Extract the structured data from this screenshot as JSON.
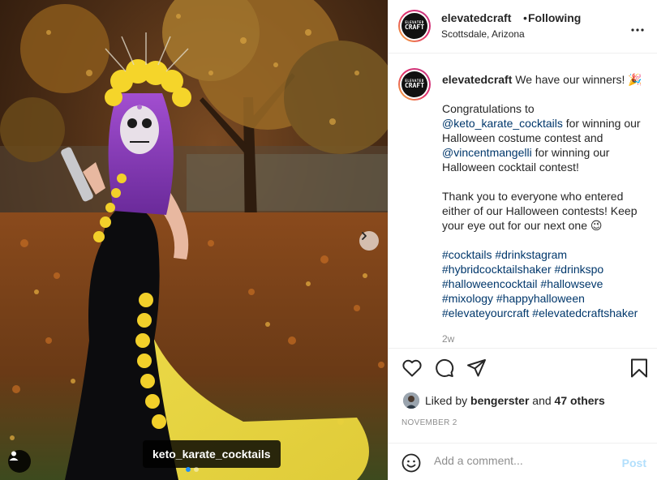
{
  "post": {
    "photo": {
      "tagged_user": "keto_karate_cocktails",
      "carousel_count": 2,
      "carousel_active_index": 0,
      "icons": {
        "next": "chevron-right-icon",
        "tagged": "user-icon"
      }
    },
    "header": {
      "avatar_text_line1": "ELEVATED",
      "avatar_text_line2": "CRAFT",
      "username": "elevatedcraft",
      "separator": "•",
      "follow_status": "Following",
      "location": "Scottsdale, Arizona",
      "more_icon": "more-horizontal-icon"
    },
    "caption": {
      "username": "elevatedcraft",
      "first_line": "We have our winners! 🎉",
      "para1_before": "Congratulations to ",
      "mention1": "@keto_karate_cocktails",
      "para1_mid": " for winning our Halloween costume contest and ",
      "mention2": "@vincentmangelli",
      "para1_after": " for winning our Halloween cocktail contest!",
      "para2": "Thank you to everyone who entered either of our Halloween contests! Keep your eye out for our next one 😉",
      "hashtags": [
        "#cocktails",
        "#drinkstagram",
        "#hybridcocktailshaker",
        "#drinkspo",
        "#halloweencocktail",
        "#hallowseve",
        "#mixology",
        "#happyhalloween",
        "#elevateyourcraft",
        "#elevatedcraftshaker"
      ],
      "time_ago": "2w"
    },
    "actions": {
      "icons": [
        "heart-icon",
        "comment-icon",
        "share-icon",
        "bookmark-icon"
      ]
    },
    "likes": {
      "prefix": "Liked by ",
      "user": "bengerster",
      "and": " and ",
      "others": "47 others"
    },
    "date": "NOVEMBER 2",
    "comment": {
      "placeholder": "Add a comment...",
      "post_label": "Post",
      "emoji_icon": "smiley-icon"
    }
  },
  "colors": {
    "link": "#00376b",
    "post_disabled": "#b2dffc",
    "muted": "#8e8e8e",
    "text": "#262626"
  }
}
